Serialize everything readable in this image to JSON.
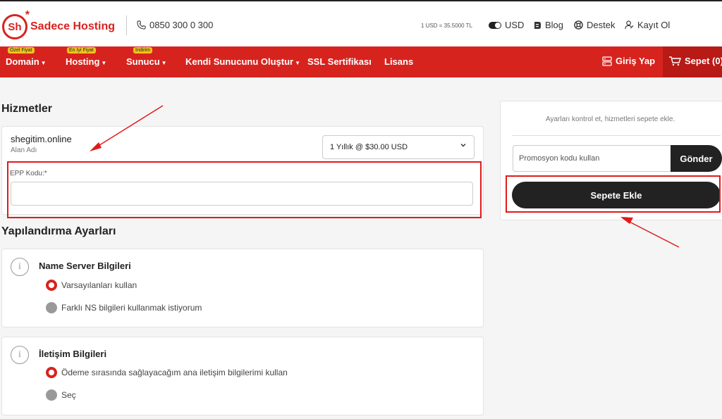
{
  "header": {
    "logo_abbr": "Sh",
    "brand": "Sadece Hosting",
    "phone": "0850 300 0 300",
    "exchange_rate": "1 USD = 35.5000 TL",
    "currency": "USD",
    "blog": "Blog",
    "support": "Destek",
    "register": "Kayıt Ol"
  },
  "nav": {
    "items": [
      {
        "label": "Domain",
        "badge": "Özel Fiyat"
      },
      {
        "label": "Hosting",
        "badge": "En İyi Fiyat"
      },
      {
        "label": "Sunucu",
        "badge": "İndirim"
      },
      {
        "label": "Kendi Sunucunu Oluştur",
        "badge": ""
      },
      {
        "label": "SSL Sertifikası",
        "badge": ""
      },
      {
        "label": "Lisans",
        "badge": ""
      }
    ],
    "login": "Giriş Yap",
    "cart": "Sepet (0)"
  },
  "services": {
    "title": "Hizmetler",
    "domain": "shegitim.online",
    "domain_type": "Alan Adı",
    "period": "1 Yıllık @ $30.00 USD",
    "epp_label": "EPP Kodu:*"
  },
  "config": {
    "title": "Yapılandırma Ayarları",
    "nameserver": {
      "title": "Name Server Bilgileri",
      "options": [
        "Varsayılanları kullan",
        "Farklı NS bilgileri kullanmak istiyorum"
      ]
    },
    "contact": {
      "title": "İletişim Bilgileri",
      "options": [
        "Ödeme sırasında sağlayacağım ana iletişim bilgilerimi kullan",
        "Seç"
      ]
    }
  },
  "sidebar": {
    "info": "Ayarları kontrol et, hizmetleri sepete ekle.",
    "promo_placeholder": "Promosyon kodu kullan",
    "send": "Gönder",
    "add_to_cart": "Sepete Ekle"
  },
  "colors": {
    "brand": "#d7231e",
    "dark": "#222222",
    "annotation": "#e01a1a"
  }
}
